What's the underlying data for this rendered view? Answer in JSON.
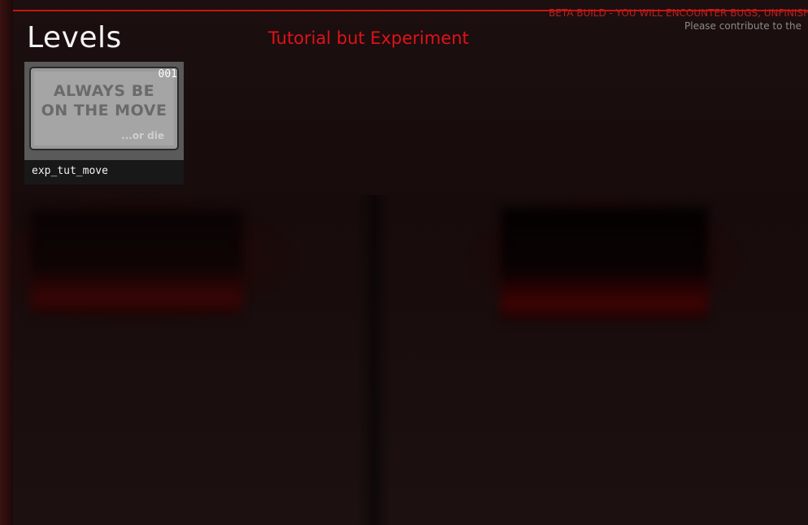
{
  "header": {
    "title": "Levels",
    "category": "Tutorial but Experiment",
    "beta_notice": "BETA BUILD - YOU WILL ENCOUNTER BUGS, UNFINISHED",
    "contribute_notice": "Please contribute to the"
  },
  "levels": [
    {
      "number": "001",
      "name": "exp_tut_move",
      "thumbnail_text": "ALWAYS BE ON THE MOVE",
      "thumbnail_subtext": "...or die"
    }
  ],
  "colors": {
    "accent": "#d10f0f",
    "category_text": "#e0121a",
    "background": "#170c0c"
  }
}
